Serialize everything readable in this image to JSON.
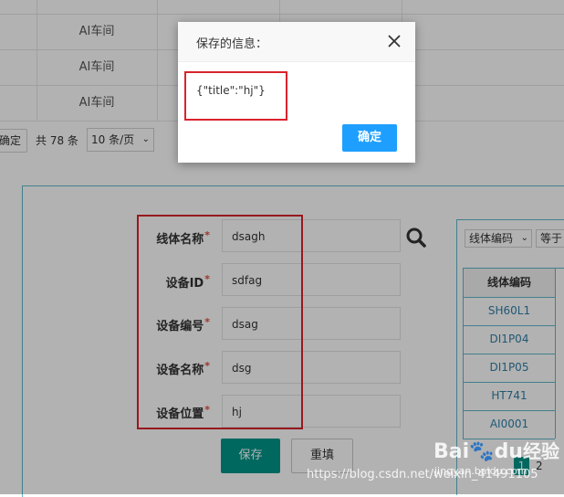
{
  "background_table": {
    "rows": [
      {
        "col2": "AI车间"
      },
      {
        "col2": "AI车间"
      },
      {
        "col2": "AI车间"
      }
    ]
  },
  "pager": {
    "confirm_label": "确定",
    "total_label": "共 78 条",
    "page_size_label": "10 条/页"
  },
  "form": {
    "fields": [
      {
        "label": "线体名称",
        "value": "dsagh"
      },
      {
        "label": "设备ID",
        "value": "sdfag"
      },
      {
        "label": "设备编号",
        "value": "dsag"
      },
      {
        "label": "设备名称",
        "value": "dsg"
      },
      {
        "label": "设备位置",
        "value": "hj"
      }
    ],
    "required_mark": "*",
    "save_label": "保存",
    "reset_label": "重填"
  },
  "right_panel": {
    "filter_field": "线体编码",
    "filter_op": "等于",
    "column_header": "线体编码",
    "rows": [
      "SH60L1",
      "DI1P04",
      "DI1P05",
      "HT741",
      "AI0001"
    ],
    "page_current": "1",
    "page_next": "2"
  },
  "dialog": {
    "title": "保存的信息：",
    "content": "{\"title\":\"hj\"}",
    "ok_label": "确定"
  },
  "watermark": {
    "url": "https://blog.csdn.net/weixin_41491105",
    "brand": "Bai",
    "brand2": "du",
    "brand_suffix": "经验",
    "brand_sub": "jingyan.baidu.com"
  },
  "colors": {
    "primary": "#009688",
    "dialog_button": "#1e9fff",
    "highlight_border": "#d9232d",
    "panel_border": "#5fb8c9",
    "required": "#e74c3c"
  }
}
